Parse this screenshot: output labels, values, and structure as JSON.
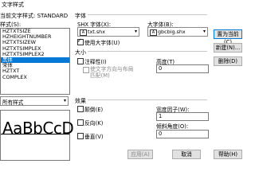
{
  "window": {
    "title": "文字样式"
  },
  "current_style": {
    "label": "当前文字样式:",
    "value": "STANDARD"
  },
  "styles_label": "样式(S):",
  "styles": [
    "HZTXTSIZE",
    "HZHEIGHTNUMBER",
    "HZTXTSIZEW",
    "HZTXTSIMPLEX",
    "HZTXTSIMPLEX2",
    "黑体",
    "宋体",
    "HZTXT",
    "COMPLEX"
  ],
  "selected_style_index": 5,
  "filter": {
    "value": "所有样式"
  },
  "preview": {
    "text": "AaBbCcD"
  },
  "font_group": {
    "label": "字体",
    "shx_label": "SHX 字体(X):",
    "shx_value": "txt.shx",
    "big_label": "大字体(B):",
    "big_value": "gbcbig.shx",
    "use_big_label": "使用大字体(U)",
    "use_big_checked": true
  },
  "size_group": {
    "label": "大小",
    "annotative_label": "注释性(I)",
    "annotative_checked": false,
    "match_layout_label": "使文字方向与布局匹配(M)",
    "height_label": "高度(T)",
    "height_value": "0"
  },
  "effects_group": {
    "label": "效果",
    "upside_label": "颠倒(E)",
    "backwards_label": "反向(K)",
    "vertical_label": "垂直(V)",
    "width_label": "宽度因子(W):",
    "width_value": "1",
    "oblique_label": "倾斜角度(O):",
    "oblique_value": "0"
  },
  "buttons": {
    "set_current": "置为当前(C)",
    "new": "新建(N)...",
    "delete": "删除(D)",
    "apply": "应用(A)",
    "cancel": "取消",
    "help": "帮助(H)"
  }
}
